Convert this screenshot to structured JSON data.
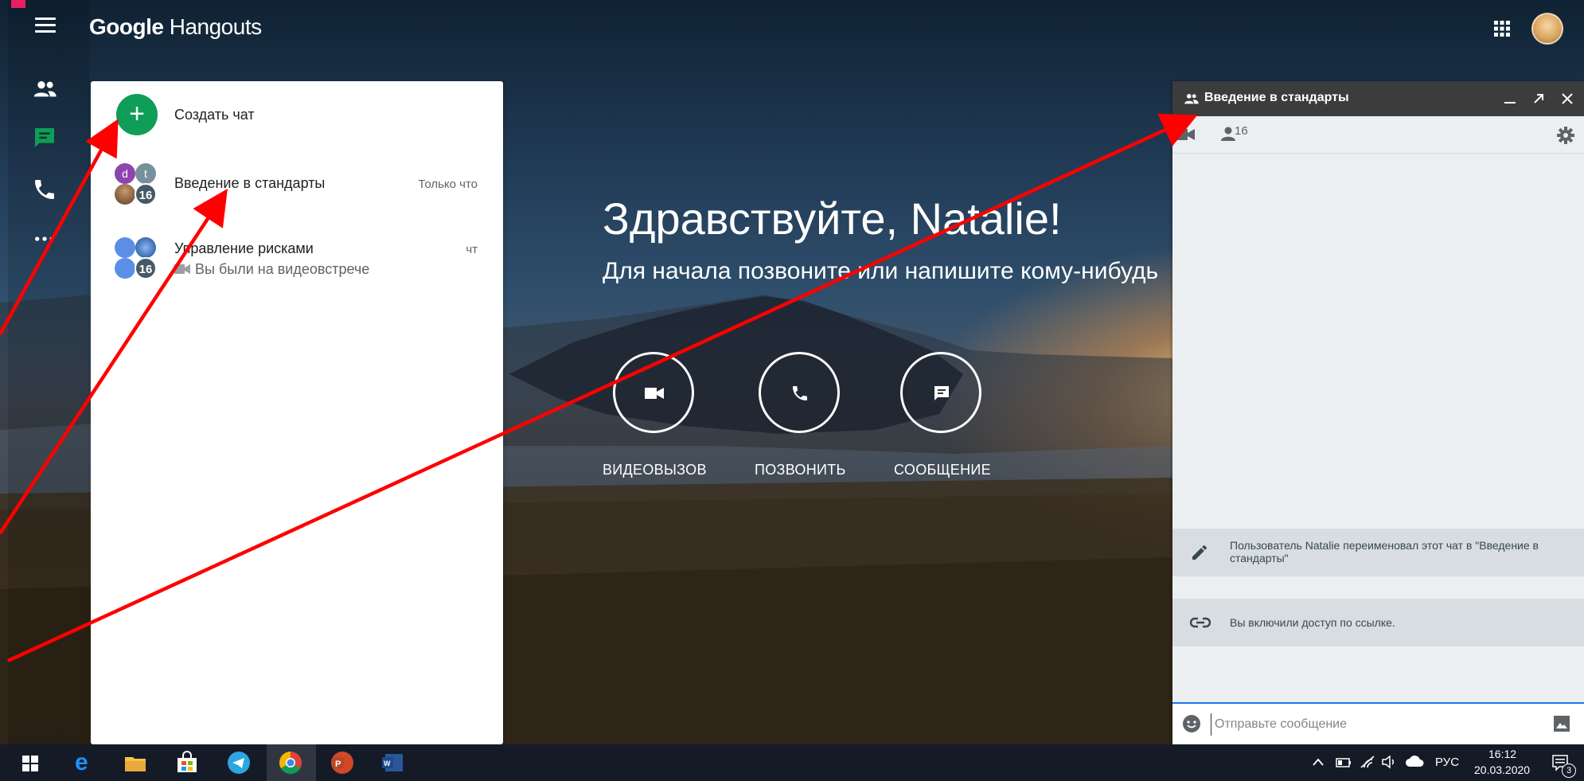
{
  "app": {
    "brand_google": "Google",
    "brand_product": "Hangouts"
  },
  "left_nav": {
    "items": [
      "contacts",
      "conversations",
      "phone",
      "more"
    ]
  },
  "new_chat": {
    "label": "Создать чат"
  },
  "conversations": [
    {
      "title": "Введение в стандарты",
      "time": "Только что",
      "avatar_letters": [
        "d",
        "t"
      ],
      "badge": "16"
    },
    {
      "title": "Управление рисками",
      "time": "чт",
      "subtitle": "Вы были на видеовстрече",
      "badge": "16"
    }
  ],
  "welcome": {
    "greeting": "Здравствуйте, Natalie!",
    "subtitle": "Для начала позвоните или напишите кому-нибудь",
    "actions": [
      {
        "label": "ВИДЕОВЫЗОВ",
        "icon": "video-camera-icon"
      },
      {
        "label": "ПОЗВОНИТЬ",
        "icon": "phone-icon"
      },
      {
        "label": "СООБЩЕНИЕ",
        "icon": "message-icon"
      }
    ]
  },
  "chat_window": {
    "title": "Введение в стандарты",
    "participants_count": "16",
    "messages": [
      {
        "icon": "pencil-icon",
        "text": "Пользователь Natalie переименовал этот чат в \"Введение в стандарты\""
      },
      {
        "icon": "link-icon",
        "text": "Вы включили доступ по ссылке."
      }
    ],
    "composer_placeholder": "Отправьте сообщение"
  },
  "taskbar": {
    "language": "РУС",
    "time": "16:12",
    "date": "20.03.2020",
    "notifications": "3"
  },
  "colors": {
    "green_accent": "#0f9d58",
    "annotation_arrow": "#ff0000",
    "chat_header": "#3c3c3c"
  }
}
